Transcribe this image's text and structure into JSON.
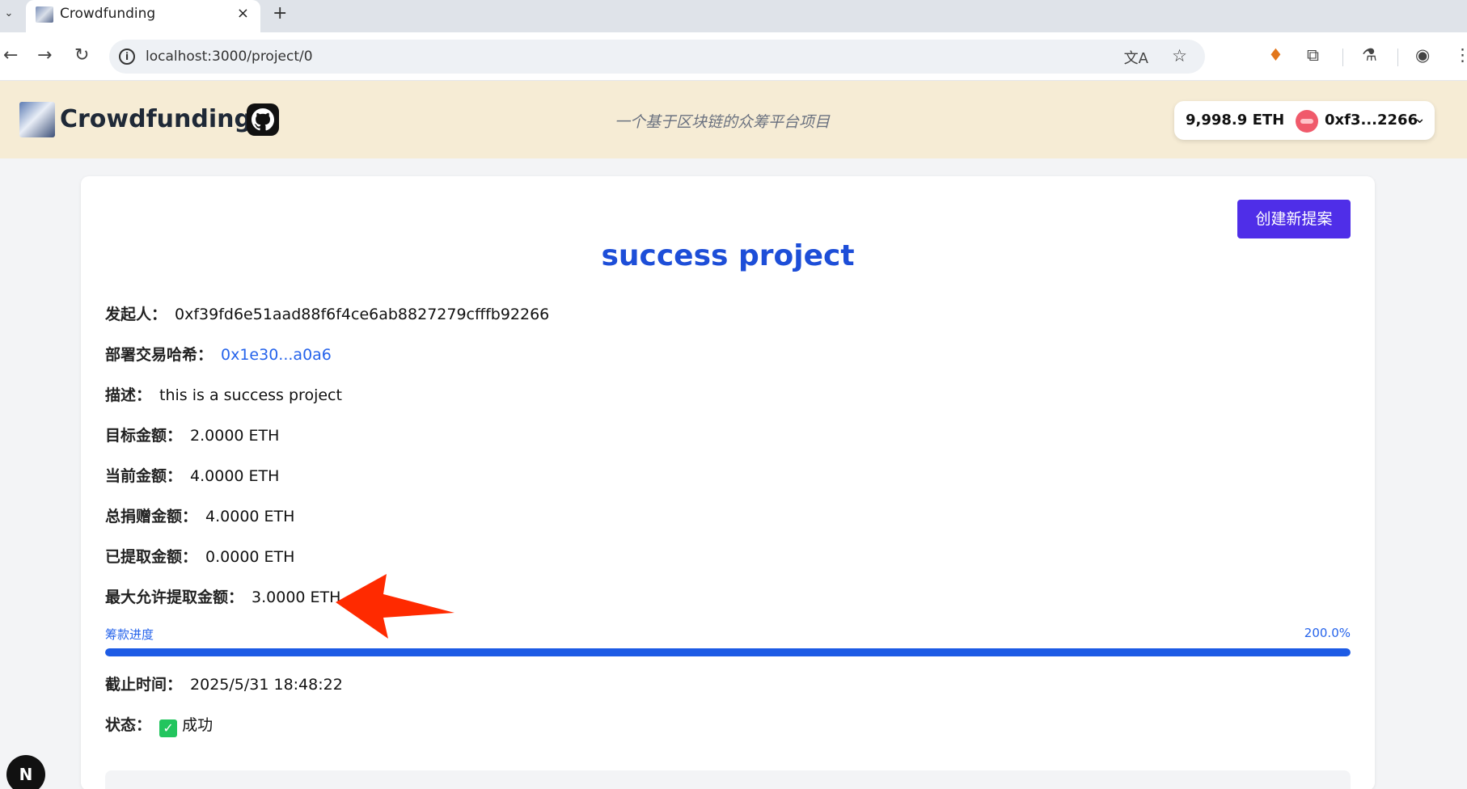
{
  "browser": {
    "tab_title": "Crowdfunding",
    "tab_close": "×",
    "new_tab": "+",
    "url": "localhost:3000/project/0"
  },
  "header": {
    "brand": "Crowdfunding",
    "tagline": "一个基于区块链的众筹平台项目",
    "wallet_balance": "9,998.9 ETH",
    "wallet_address": "0xf3...2266"
  },
  "project": {
    "create_button": "创建新提案",
    "title": "success project",
    "fields": [
      {
        "label": "发起人：",
        "value": "0xf39fd6e51aad88f6f4ce6ab8827279cfffb92266"
      },
      {
        "label": "部署交易哈希：",
        "value": "0x1e30...a0a6"
      },
      {
        "label": "描述：",
        "value": "this is a success project"
      },
      {
        "label": "目标金额：",
        "value": "2.0000 ETH"
      },
      {
        "label": "当前金额：",
        "value": "4.0000 ETH"
      },
      {
        "label": "总捐赠金额：",
        "value": "4.0000 ETH"
      },
      {
        "label": "已提取金额：",
        "value": "0.0000 ETH"
      },
      {
        "label": "最大允许提取金额：",
        "value": "3.0000 ETH"
      }
    ],
    "progress_label": "筹款进度",
    "progress_percent_text": "200.0%",
    "progress_fill": 1.0,
    "deadline": {
      "label": "截止时间：",
      "value": "2025/5/31 18:48:22"
    },
    "status": {
      "label": "状态：",
      "icon": "✓",
      "value": "成功"
    }
  },
  "next_badge": "N",
  "colors": {
    "accent_button": "#4f2ee8",
    "title": "#1d4ed8",
    "link": "#2563eb",
    "header_bg": "#f6ecd5",
    "annotation_arrow": "#ff2a00"
  }
}
